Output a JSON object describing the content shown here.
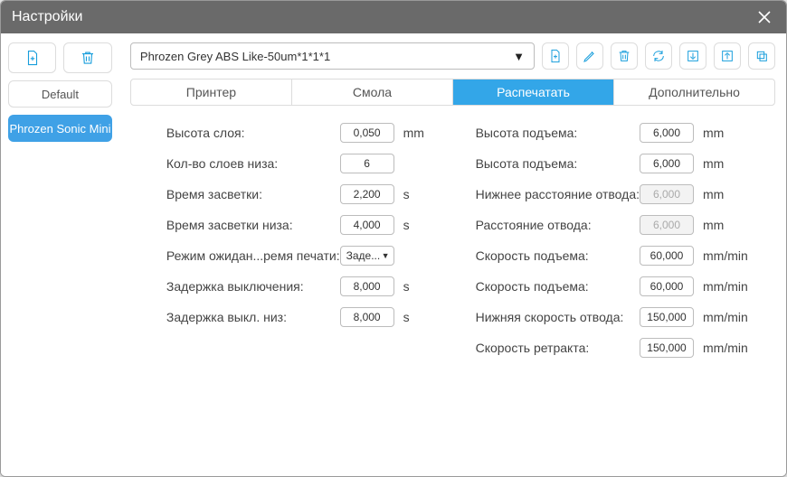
{
  "window": {
    "title": "Настройки"
  },
  "sidebar": {
    "profiles": [
      {
        "label": "Default",
        "active": false
      },
      {
        "label": "Phrozen Sonic Mini",
        "active": true
      }
    ]
  },
  "profile_select": {
    "value": "Phrozen Grey ABS Like-50um*1*1*1"
  },
  "tabs": [
    {
      "label": "Принтер",
      "active": false
    },
    {
      "label": "Смола",
      "active": false
    },
    {
      "label": "Распечатать",
      "active": true
    },
    {
      "label": "Дополнительно",
      "active": false
    }
  ],
  "left_params": [
    {
      "label": "Высота слоя:",
      "value": "0,050",
      "unit": "mm",
      "type": "input"
    },
    {
      "label": "Кол-во слоев низа:",
      "value": "6",
      "unit": "",
      "type": "input"
    },
    {
      "label": "Время засветки:",
      "value": "2,200",
      "unit": "s",
      "type": "input"
    },
    {
      "label": "Время засветки низа:",
      "value": "4,000",
      "unit": "s",
      "type": "input"
    },
    {
      "label": "Режим ожидан...ремя печати:",
      "value": "Заде...",
      "unit": "",
      "type": "select"
    },
    {
      "label": "Задержка выключения:",
      "value": "8,000",
      "unit": "s",
      "type": "input"
    },
    {
      "label": "Задержка выкл. низ:",
      "value": "8,000",
      "unit": "s",
      "type": "input"
    }
  ],
  "right_params": [
    {
      "label": "Высота подъема:",
      "value": "6,000",
      "unit": "mm",
      "type": "input"
    },
    {
      "label": "Высота подъема:",
      "value": "6,000",
      "unit": "mm",
      "type": "input"
    },
    {
      "label": "Нижнее расстояние отвода:",
      "value": "6,000",
      "unit": "mm",
      "type": "input",
      "disabled": true
    },
    {
      "label": "Расстояние отвода:",
      "value": "6,000",
      "unit": "mm",
      "type": "input",
      "disabled": true
    },
    {
      "label": "Скорость подъема:",
      "value": "60,000",
      "unit": "mm/min",
      "type": "input"
    },
    {
      "label": "Скорость подъема:",
      "value": "60,000",
      "unit": "mm/min",
      "type": "input"
    },
    {
      "label": "Нижняя скорость отвода:",
      "value": "150,000",
      "unit": "mm/min",
      "type": "input"
    },
    {
      "label": "Скорость ретракта:",
      "value": "150,000",
      "unit": "mm/min",
      "type": "input"
    }
  ]
}
